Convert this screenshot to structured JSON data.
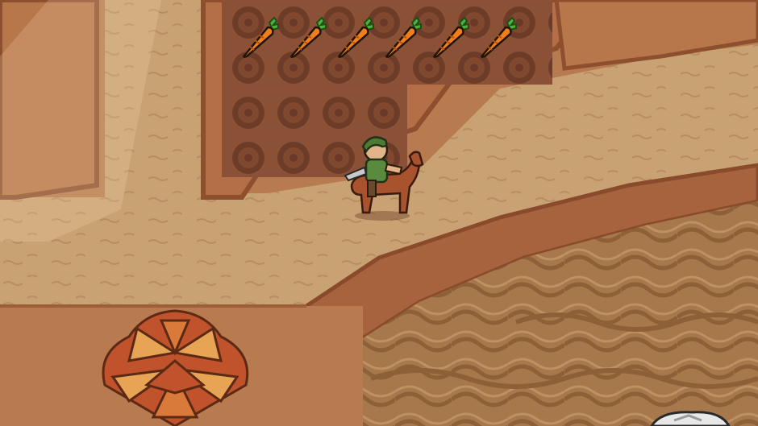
{
  "hud": {
    "carrot_count": 6,
    "icon": "carrot-icon"
  },
  "colors": {
    "dirt_path": "#c9a274",
    "dirt_dark": "#a9784e",
    "cliff_orange": "#b8764b",
    "cliff_edge": "#8e4f2f",
    "tilled_soil": "#7a4630",
    "carrot_orange": "#f07f1a",
    "carrot_leaf": "#4bb23a",
    "bush_red": "#c0532c",
    "bush_yellow": "#e6a454"
  },
  "scene": {
    "location": "autumn-hillside"
  }
}
